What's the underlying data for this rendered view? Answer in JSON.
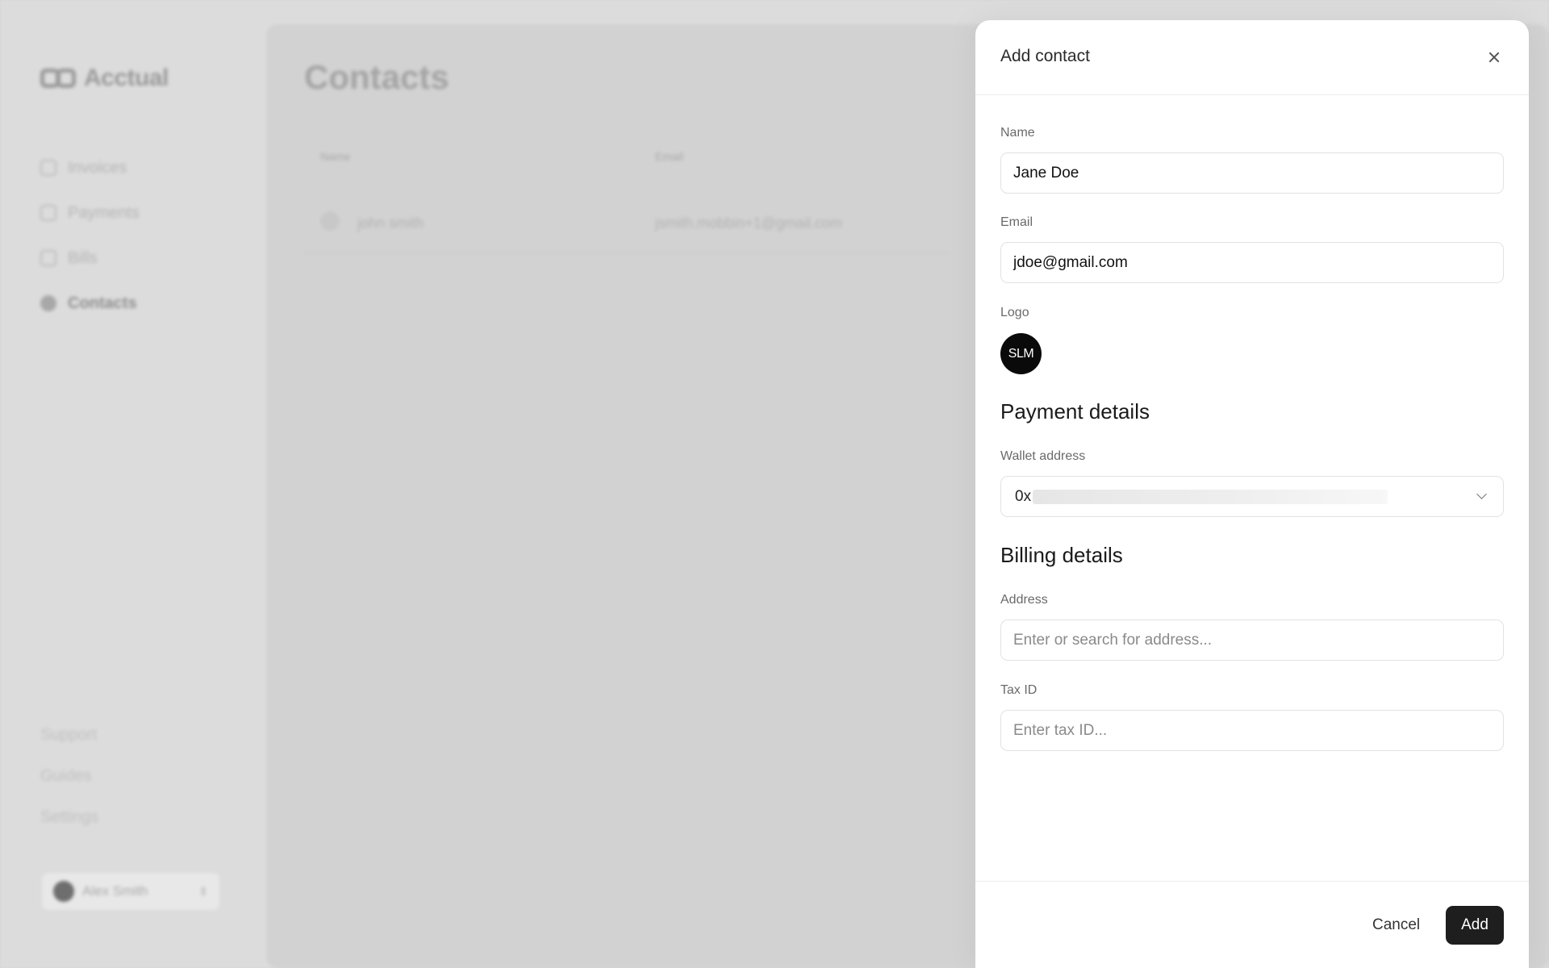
{
  "background": {
    "brand_name": "Acctual",
    "nav_items": [
      "Invoices",
      "Payments",
      "Bills",
      "Contacts"
    ],
    "active_nav": "Contacts",
    "footer_links": [
      "Support",
      "Guides",
      "Settings"
    ],
    "user_name": "Alex Smith",
    "page_title": "Contacts",
    "table_headers": [
      "Name",
      "Email"
    ],
    "rows": [
      {
        "name": "john smith",
        "email": "jsmith.mobbin+1@gmail.com"
      }
    ]
  },
  "drawer": {
    "title": "Add contact",
    "name_label": "Name",
    "name_value": "Jane Doe",
    "email_label": "Email",
    "email_value": "jdoe@gmail.com",
    "logo_label": "Logo",
    "logo_text": "SLM",
    "payment_title": "Payment details",
    "wallet_label": "Wallet address",
    "wallet_value": "0x",
    "billing_title": "Billing details",
    "address_label": "Address",
    "address_placeholder": "Enter or search for address...",
    "tax_label": "Tax ID",
    "tax_placeholder": "Enter tax ID...",
    "cancel_label": "Cancel",
    "add_label": "Add"
  },
  "colors": {
    "primary_button": "#1e1e1e",
    "logo_bg": "#0a0a0a"
  }
}
